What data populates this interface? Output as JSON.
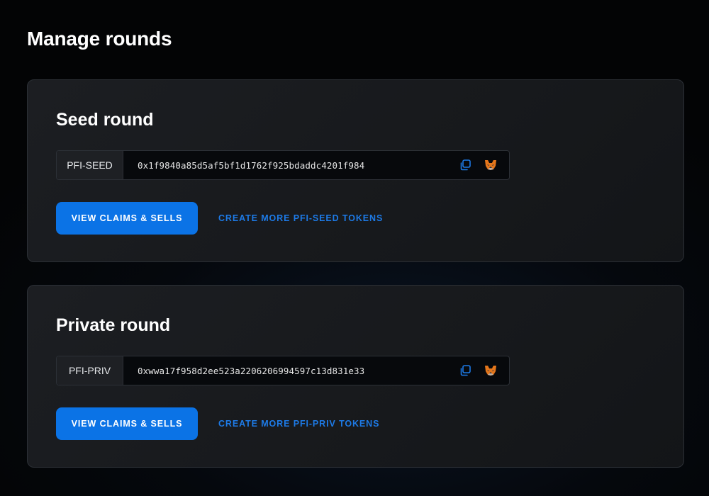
{
  "page": {
    "title": "Manage rounds"
  },
  "rounds": [
    {
      "title": "Seed round",
      "token_symbol": "PFI-SEED",
      "token_address": "0x1f9840a85d5af5bf1d1762f925bdaddc4201f984",
      "primary_action_label": "VIEW CLAIMS & SELLS",
      "secondary_action_label": "CREATE MORE PFI-SEED TOKENS"
    },
    {
      "title": "Private round",
      "token_symbol": "PFI-PRIV",
      "token_address": "0xwwa17f958d2ee523a2206206994597c13d831e33",
      "primary_action_label": "VIEW CLAIMS & SELLS",
      "secondary_action_label": "CREATE MORE PFI-PRIV TOKENS"
    }
  ],
  "icons": {
    "copy": "copy-icon",
    "wallet": "metamask-fox-icon"
  },
  "colors": {
    "accent": "#0b73e6",
    "link": "#1d7ae6",
    "card_border": "#2c3036"
  }
}
